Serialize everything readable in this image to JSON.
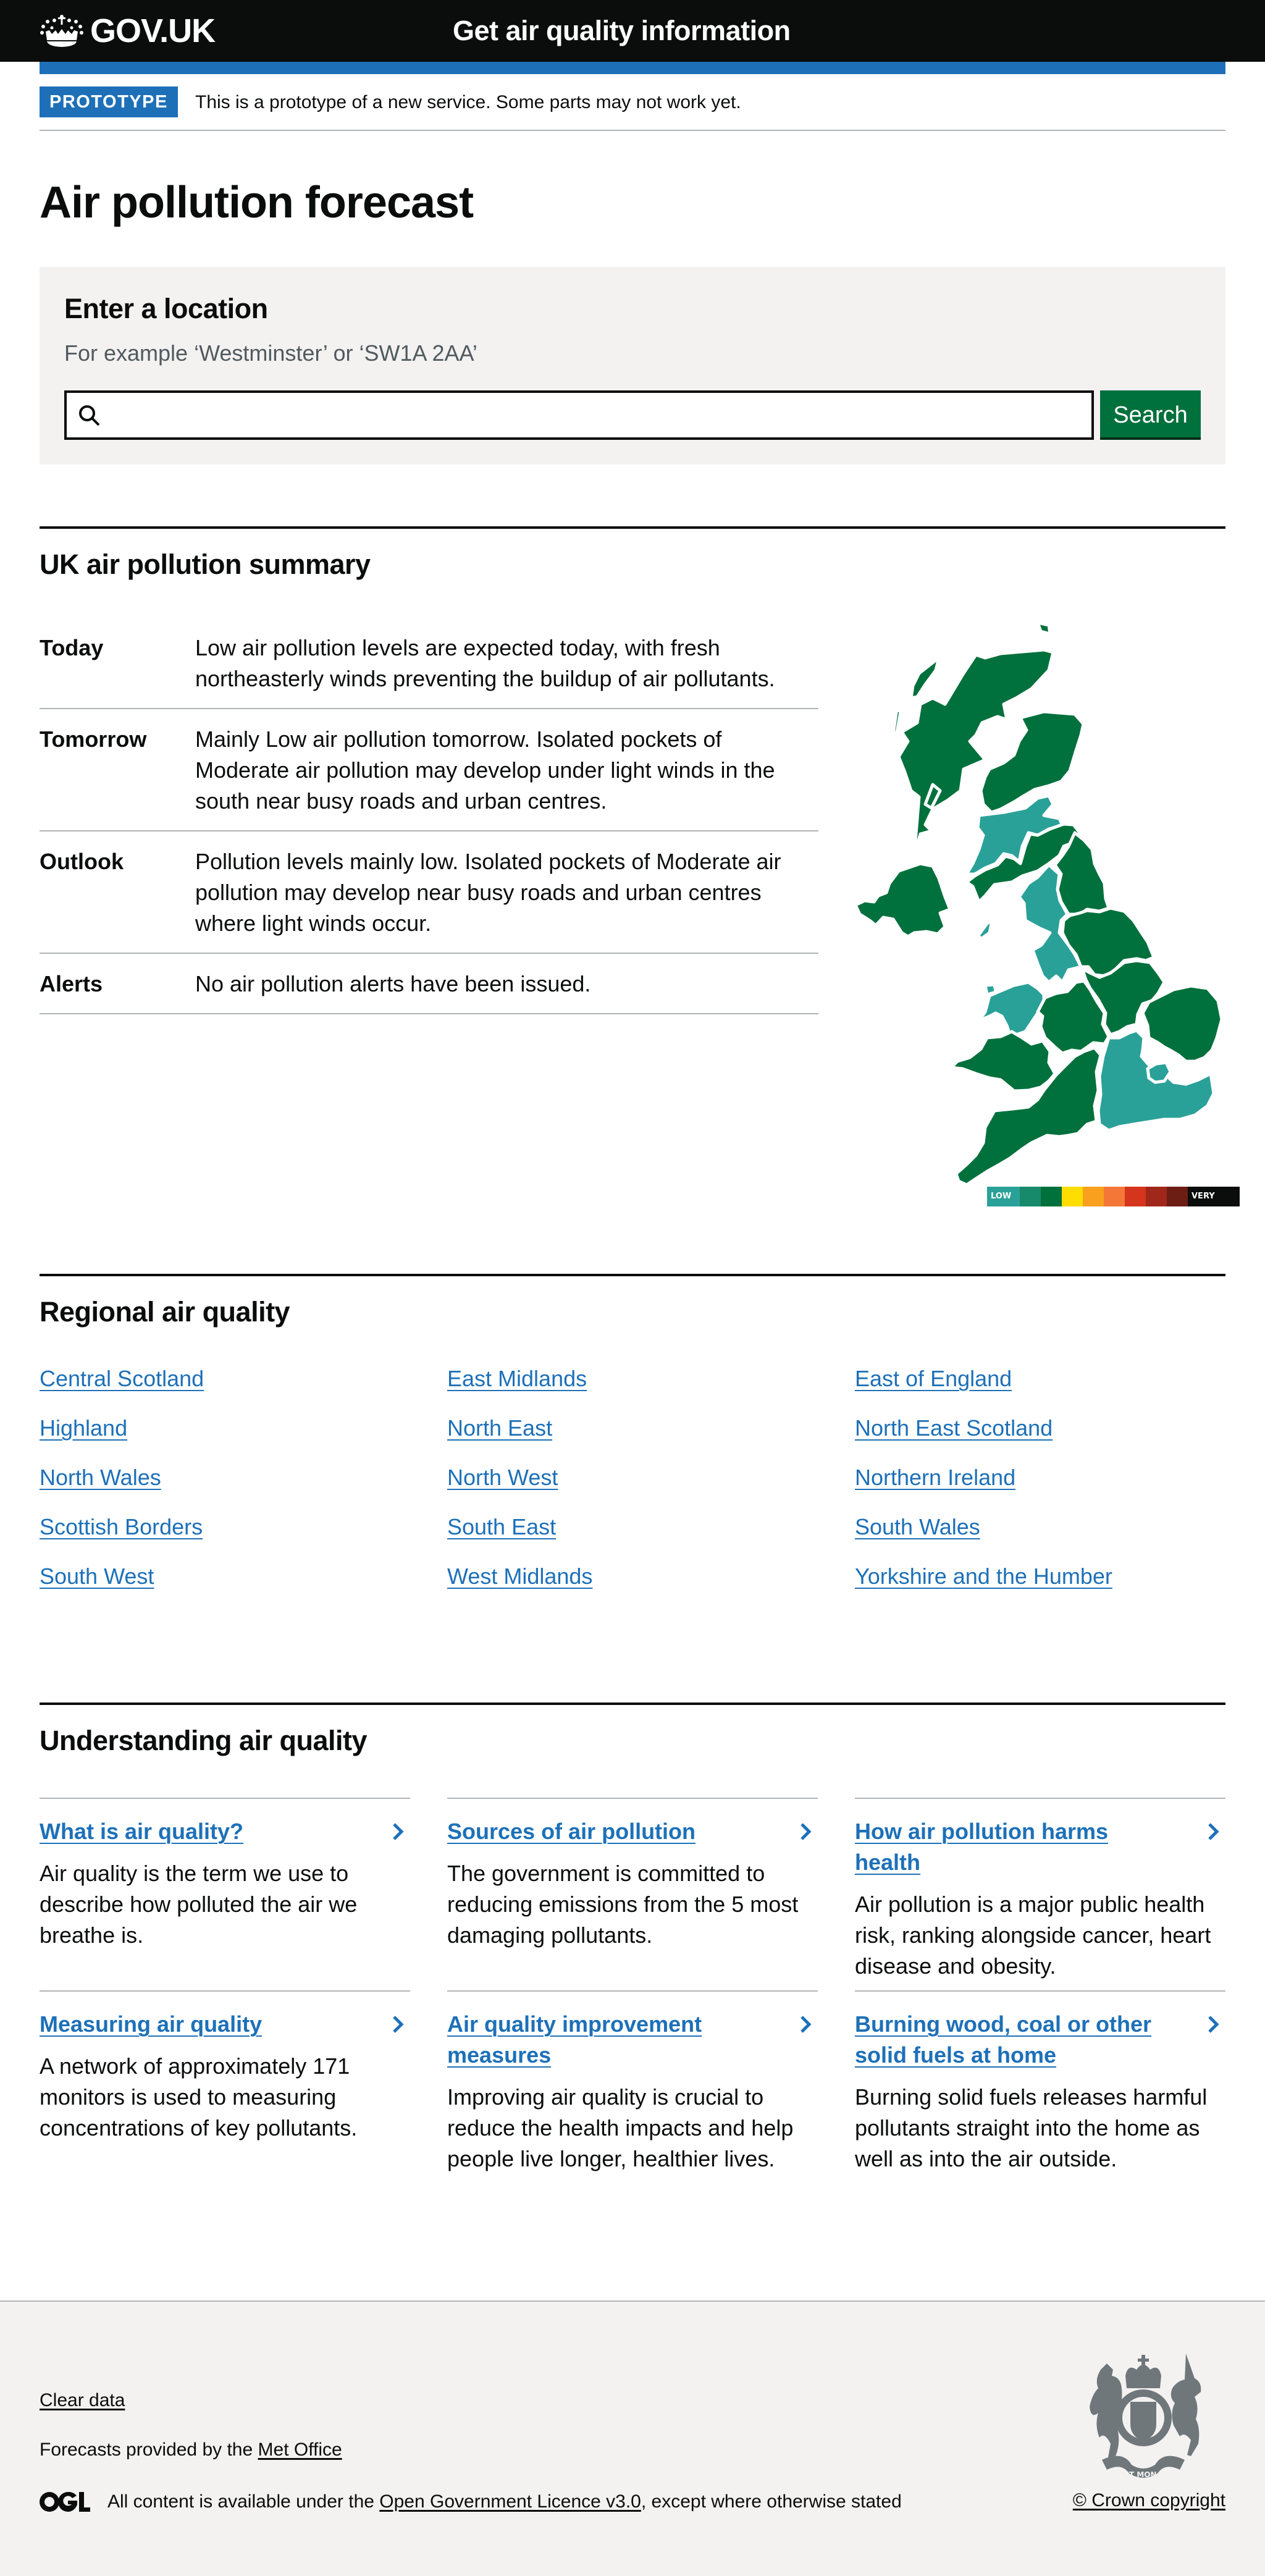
{
  "header": {
    "logo_text": "GOV.UK",
    "service_name": "Get air quality information"
  },
  "phase_banner": {
    "tag": "PROTOTYPE",
    "text": "This is a prototype of a new service. Some parts may not work yet."
  },
  "page_title": "Air pollution forecast",
  "search": {
    "heading": "Enter a location",
    "hint": "For example ‘Westminster’ or ‘SW1A 2AA’",
    "value": "",
    "placeholder": "",
    "button_label": "Search"
  },
  "summary": {
    "heading": "UK air pollution summary",
    "rows": [
      {
        "key": "Today",
        "value": "Low air pollution levels are expected today, with fresh northeasterly winds preventing the buildup of air pollutants."
      },
      {
        "key": "Tomorrow",
        "value": "Mainly Low air pollution tomorrow. Isolated pockets of Moderate air pollution may develop under light winds in the south near busy roads and urban centres."
      },
      {
        "key": "Outlook",
        "value": "Pollution levels mainly low. Isolated pockets of Moderate air pollution may develop near busy roads and urban centres where light winds occur."
      },
      {
        "key": "Alerts",
        "value": "No air pollution alerts have been issued."
      }
    ]
  },
  "map": {
    "colors": {
      "band1": "#2aa198",
      "band3": "#00703c",
      "border": "#ffffff"
    },
    "regions": [
      {
        "name": "Highland",
        "band": 3
      },
      {
        "name": "North East Scotland",
        "band": 3
      },
      {
        "name": "Central Scotland",
        "band": 1
      },
      {
        "name": "Scottish Borders",
        "band": 3
      },
      {
        "name": "Northern Ireland",
        "band": 3
      },
      {
        "name": "North East",
        "band": 3
      },
      {
        "name": "North West",
        "band": 1
      },
      {
        "name": "Yorkshire and the Humber",
        "band": 3
      },
      {
        "name": "North Wales",
        "band": 1
      },
      {
        "name": "East Midlands",
        "band": 3
      },
      {
        "name": "West Midlands",
        "band": 3
      },
      {
        "name": "East of England",
        "band": 3
      },
      {
        "name": "South Wales",
        "band": 3
      },
      {
        "name": "South West",
        "band": 3
      },
      {
        "name": "South East",
        "band": 1
      },
      {
        "name": "London",
        "band": 1
      }
    ],
    "legend": {
      "low_label": "LOW",
      "high_label": "VERY HIGH",
      "colors": [
        "#2aa198",
        "#178a6c",
        "#00703c",
        "#ffdd00",
        "#f9a11f",
        "#f47738",
        "#d4351c",
        "#a1271a",
        "#6c1e14",
        "#0b0c0c"
      ]
    }
  },
  "regional": {
    "heading": "Regional air quality",
    "links": [
      "Central Scotland",
      "East Midlands",
      "East of England",
      "Highland",
      "North East",
      "North East Scotland",
      "North Wales",
      "North West",
      "Northern Ireland",
      "Scottish Borders",
      "South East",
      "South Wales",
      "South West",
      "West Midlands",
      "Yorkshire and the Humber"
    ]
  },
  "understanding": {
    "heading": "Understanding air quality",
    "cards": [
      {
        "title": "What is air quality?",
        "body": "Air quality is the term we use to describe how polluted the air we breathe is."
      },
      {
        "title": "Sources of air pollution",
        "body": "The government is committed to reducing emissions from the 5 most damaging pollutants."
      },
      {
        "title": "How air pollution harms health",
        "body": "Air pollution is a major public health risk, ranking alongside cancer, heart disease and obesity."
      },
      {
        "title": "Measuring air quality",
        "body": "A network of approximately 171 monitors is used to measuring concentrations of key pollutants."
      },
      {
        "title": "Air quality improvement measures",
        "body": "Improving air quality is crucial to reduce the health impacts and help people live longer, healthier lives."
      },
      {
        "title": "Burning wood, coal or other solid fuels at home",
        "body": "Burning solid fuels releases harmful pollutants straight into the home as well as into the air outside."
      }
    ]
  },
  "footer": {
    "clear_data": "Clear data",
    "forecast_prefix": "Forecasts provided by the ",
    "met_office": "Met Office",
    "licence_prefix": "All content is available under the ",
    "licence_link": "Open Government Licence v3.0",
    "licence_suffix": ", except where otherwise stated",
    "copyright": "© Crown copyright",
    "crest_motto": "DIEU ET MON DROIT"
  }
}
